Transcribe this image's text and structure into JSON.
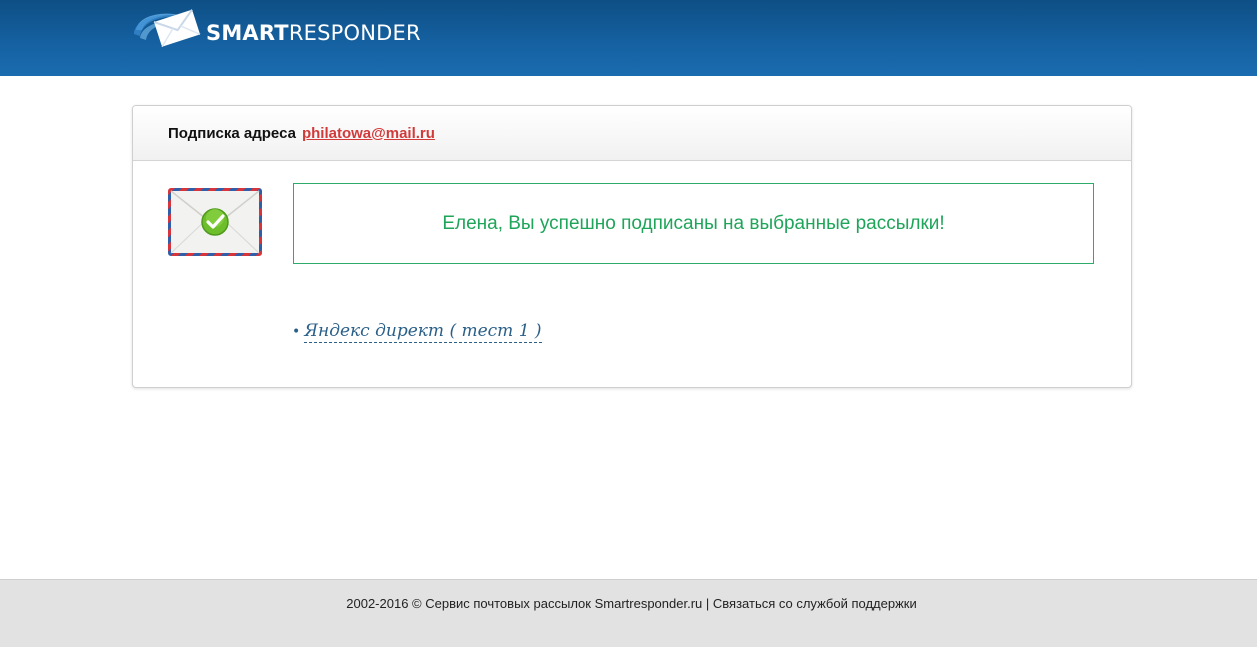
{
  "header": {
    "brand_bold": "SMART",
    "brand_light": "RESPONDER",
    "logo_icon": "envelope-swoosh-icon"
  },
  "card": {
    "title_prefix": "Подписка адреса",
    "email": "philatowa@mail.ru",
    "envelope_icon": "envelope-check-icon",
    "success_message": "Елена, Вы успешно подписаны на выбранные рассылки!",
    "subscriptions": [
      {
        "bullet": "•",
        "label": "Яндекс директ ( тест 1 )"
      }
    ]
  },
  "footer": {
    "copyright": "2002-2016 © Сервис почтовых рассылок Smartresponder.ru",
    "separator": "|",
    "support_link": "Связаться со службой поддержки"
  },
  "colors": {
    "header_blue": "#1560a0",
    "email_red": "#d23a3a",
    "success_green": "#1ea55a",
    "link_blue": "#2a5f88",
    "footer_gray": "#e2e2e2"
  }
}
